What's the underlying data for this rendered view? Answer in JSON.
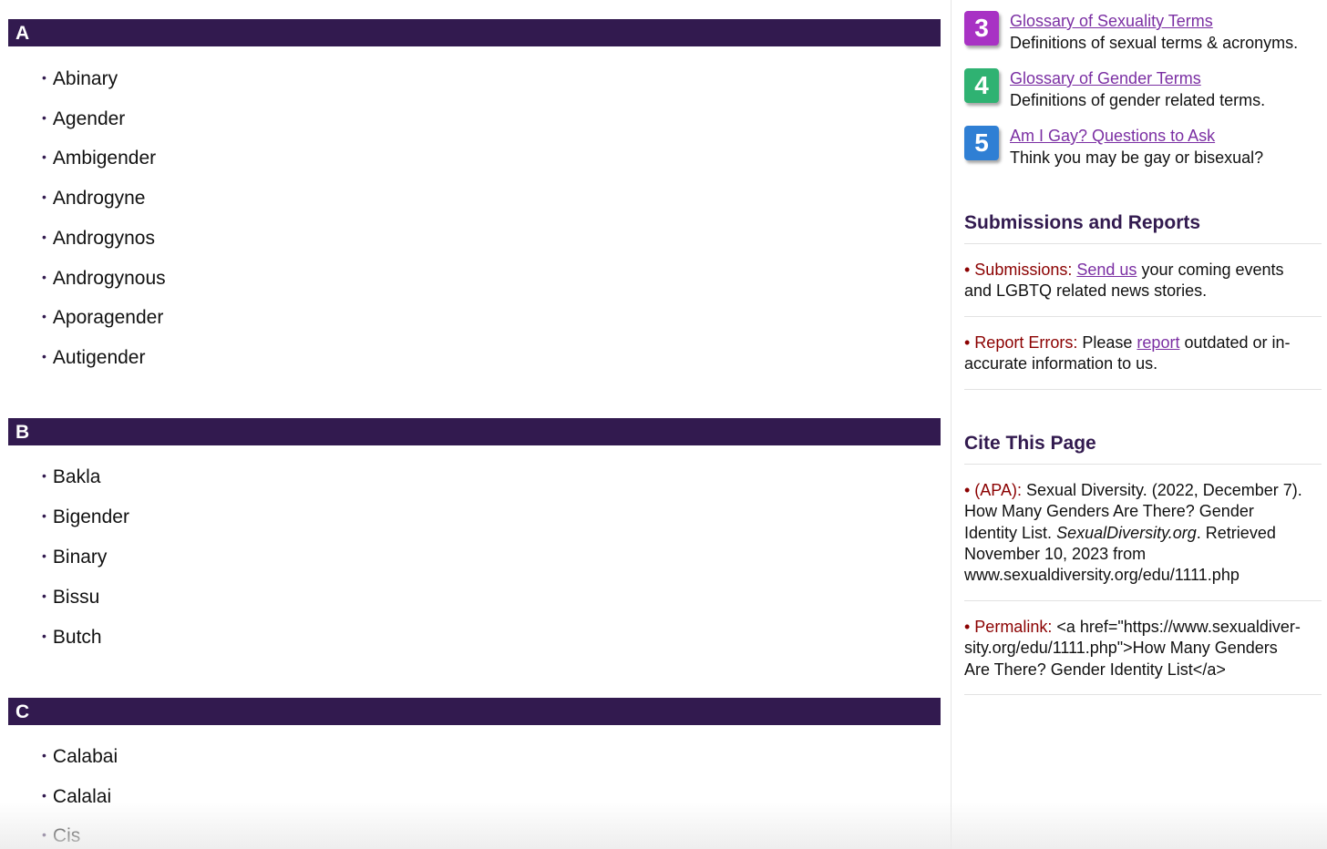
{
  "sections": [
    {
      "letter": "A",
      "terms": [
        "Abinary",
        "Agender",
        "Ambigender",
        "Androgyne",
        "Androgynos",
        "Androgynous",
        "Aporagender",
        "Autigender"
      ]
    },
    {
      "letter": "B",
      "terms": [
        "Bakla",
        "Bigender",
        "Binary",
        "Bissu",
        "Butch"
      ]
    },
    {
      "letter": "C",
      "terms": [
        "Calabai",
        "Calalai",
        "Cis"
      ]
    }
  ],
  "sidebar": {
    "related": [
      {
        "num": "3",
        "color": "#a832c4",
        "title": "Glossary of Sexuality Terms",
        "desc": "Definitions of sexual terms & acronyms."
      },
      {
        "num": "4",
        "color": "#2fb272",
        "title": "Glossary of Gender Terms",
        "desc": "Definitions of gender related terms."
      },
      {
        "num": "5",
        "color": "#2f7fd4",
        "title": "Am I Gay? Questions to Ask",
        "desc": "Think you may be gay or bisexual?"
      }
    ],
    "submissions": {
      "heading": "Submissions and Reports",
      "submit_label": "• Submissions:",
      "submit_link": "Send us",
      "submit_text_1": "your coming events",
      "submit_text_2": "and LGBTQ related news stories.",
      "report_label": "• Report Errors:",
      "report_pre": "Please",
      "report_link": "report",
      "report_text_1": "outdated or in-",
      "report_text_2": "accurate information to us."
    },
    "cite": {
      "heading": "Cite This Page",
      "apa_label": "• (APA):",
      "apa_l1": "Sexual Diversity. (2022, December 7).",
      "apa_l2": "How Many Genders Are There? Gender",
      "apa_l3a": "Identity List.",
      "apa_l3b": "SexualDiversity.org",
      "apa_l3c": ". Retrieved",
      "apa_l4": "November 10, 2023 from",
      "apa_l5": "www.sexualdiversity.org/edu/1111.php",
      "perma_label": "• Permalink:",
      "perma_l1": "<a href=\"https://www.sexualdiver-",
      "perma_l2": "sity.org/edu/1111.php\">How Many Genders",
      "perma_l3": "Are There? Gender Identity List</a>"
    }
  }
}
